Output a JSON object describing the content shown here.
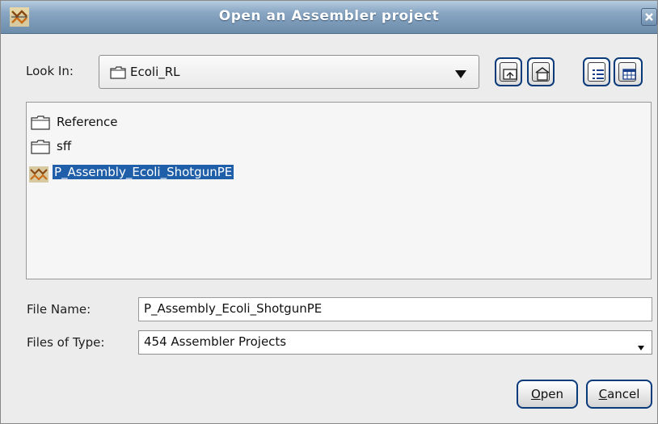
{
  "window": {
    "title": "Open an Assembler project",
    "close_icon": "close-icon",
    "app_icon": "assembler-project-icon"
  },
  "lookin": {
    "label": "Look In:",
    "value": "Ecoli_RL",
    "icon": "folder-icon"
  },
  "toolbar": {
    "buttons": [
      {
        "name": "up-one-level",
        "icon": "folder-up-icon"
      },
      {
        "name": "home",
        "icon": "home-icon"
      },
      {
        "name": "list-view",
        "icon": "list-view-icon"
      },
      {
        "name": "details-view",
        "icon": "details-view-icon"
      }
    ]
  },
  "files": {
    "items": [
      {
        "name": "Reference",
        "icon": "folder-icon",
        "selected": false
      },
      {
        "name": "sff",
        "icon": "folder-icon",
        "selected": false
      },
      {
        "name": "P_Assembly_Ecoli_ShotgunPE",
        "icon": "assembler-project-icon",
        "selected": true
      }
    ]
  },
  "filename": {
    "label": "File Name:",
    "value": "P_Assembly_Ecoli_ShotgunPE"
  },
  "filetype": {
    "label": "Files of Type:",
    "value": "454 Assembler Projects"
  },
  "buttons": {
    "open_mnemonic": "O",
    "open_rest": "pen",
    "cancel_mnemonic": "C",
    "cancel_rest": "ancel"
  },
  "colors": {
    "titlebar": "#7f9ebd",
    "selection": "#1f5ea8",
    "button_border": "#0a3a7a"
  }
}
